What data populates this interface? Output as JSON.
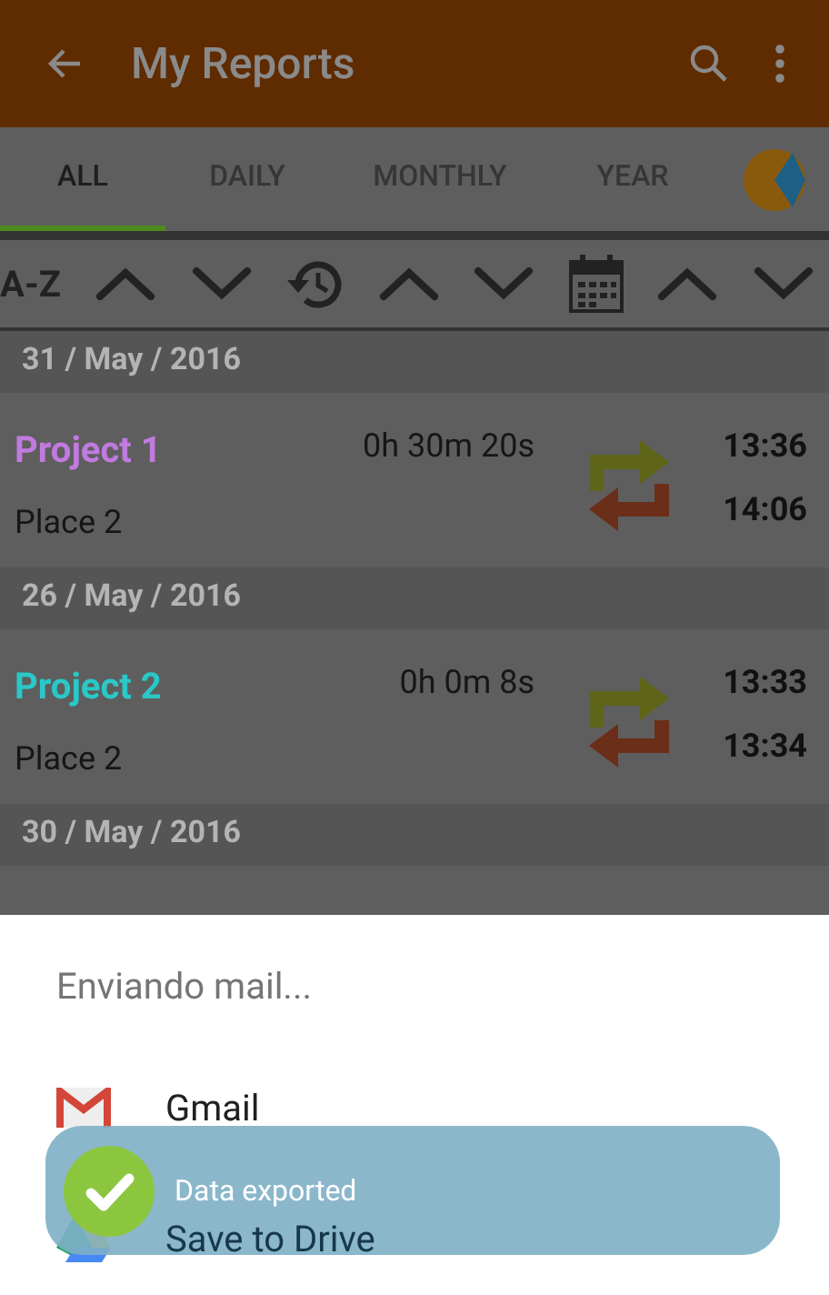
{
  "app_bar": {
    "title": "My Reports"
  },
  "tabs": [
    {
      "label": "ALL",
      "selected": true
    },
    {
      "label": "DAILY",
      "selected": false
    },
    {
      "label": "MONTHLY",
      "selected": false
    },
    {
      "label": "YEAR",
      "selected": false
    }
  ],
  "sort_bar": {
    "label": "A-Z"
  },
  "groups": [
    {
      "date": "31 / May / 2016",
      "entries": [
        {
          "project": "Project 1",
          "color": "#c07ae0",
          "place": "Place 2",
          "duration": "0h 30m 20s",
          "start": "13:36",
          "end": "14:06"
        }
      ]
    },
    {
      "date": "26 / May / 2016",
      "entries": [
        {
          "project": "Project 2",
          "color": "#2ac8c8",
          "place": "Place 2",
          "duration": "0h 0m 8s",
          "start": "13:33",
          "end": "13:34"
        }
      ]
    },
    {
      "date": "30 / May / 2016"
    }
  ],
  "share_sheet": {
    "title": "Enviando mail...",
    "items": [
      {
        "kind": "gmail",
        "label": "Gmail"
      },
      {
        "kind": "drive",
        "label": "Save to Drive"
      }
    ]
  },
  "toast": {
    "message": "Data exported"
  }
}
